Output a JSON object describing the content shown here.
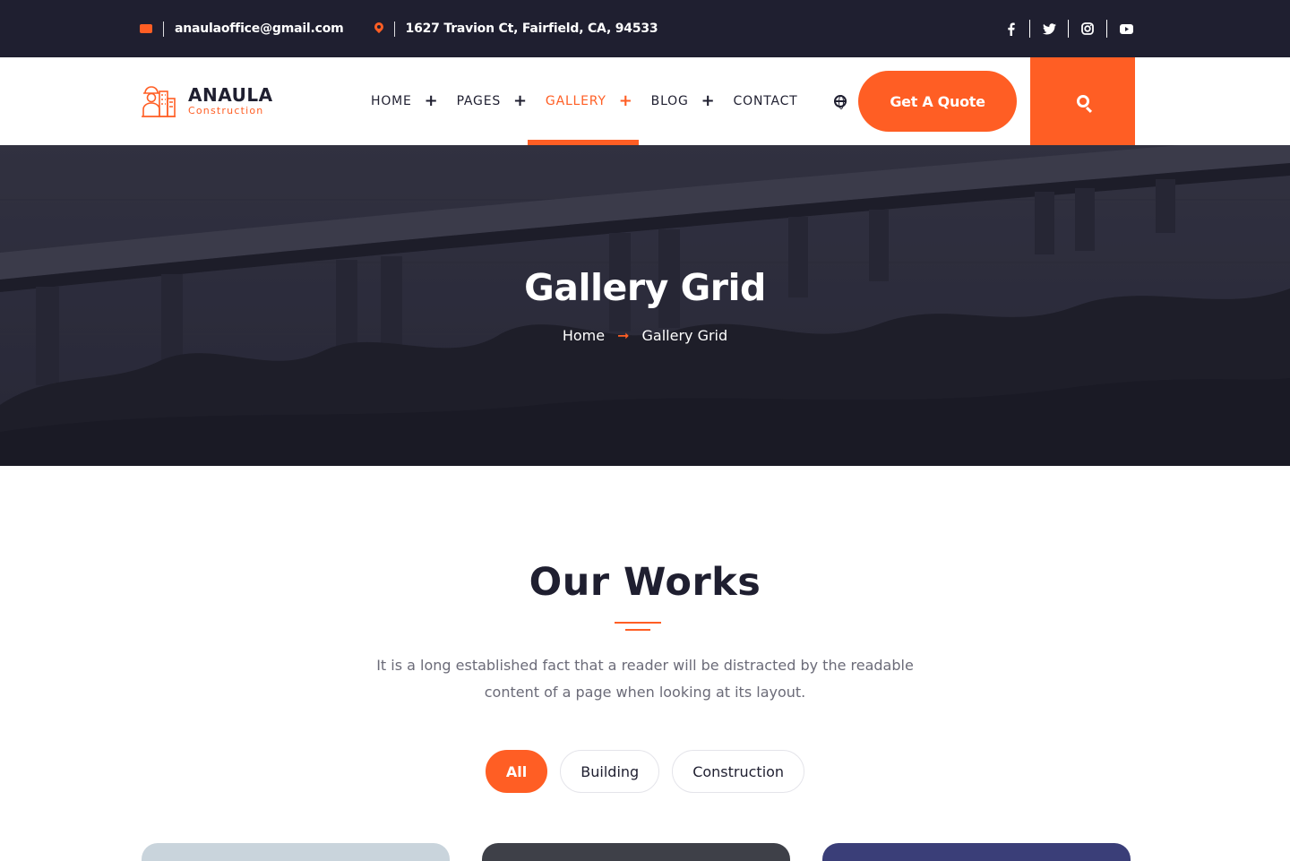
{
  "topbar": {
    "email": "anaulaoffice@gmail.com",
    "address": "1627 Travion Ct, Fairfield, CA, 94533",
    "socials": [
      {
        "icon": "facebook-icon",
        "glyph": "f"
      },
      {
        "icon": "twitter-icon",
        "glyph": "🐦"
      },
      {
        "icon": "instagram-icon",
        "glyph": "◎"
      },
      {
        "icon": "youtube-icon",
        "glyph": "▶"
      }
    ]
  },
  "header": {
    "brand": "ANAULA",
    "brand_sub": "Construction",
    "nav": [
      {
        "label": "HOME",
        "has_plus": true
      },
      {
        "label": "PAGES",
        "has_plus": true
      },
      {
        "label": "GALLERY",
        "has_plus": true,
        "active": true
      },
      {
        "label": "BLOG",
        "has_plus": true
      },
      {
        "label": "CONTACT",
        "has_plus": false
      }
    ],
    "quote_label": "Get A Quote"
  },
  "hero": {
    "title": "Gallery Grid",
    "breadcrumb_home": "Home",
    "breadcrumb_current": "Gallery Grid"
  },
  "works": {
    "title": "Our Works",
    "description": "It is a long established fact that a reader will be distracted by the readable content of a page when looking at its layout.",
    "filters": [
      {
        "label": "All",
        "active": true
      },
      {
        "label": "Building",
        "active": false
      },
      {
        "label": "Construction",
        "active": false
      }
    ]
  },
  "colors": {
    "accent": "#ff5e24",
    "dark": "#1f1f30"
  }
}
